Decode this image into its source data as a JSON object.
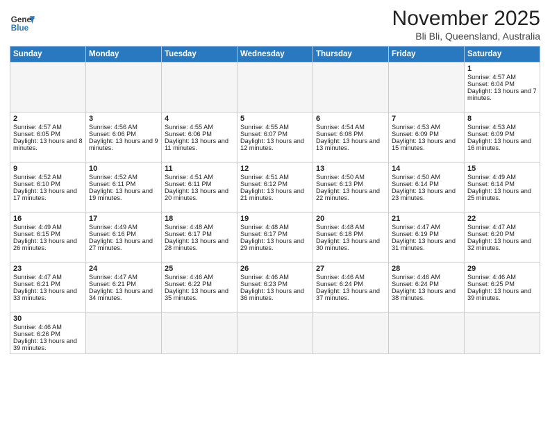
{
  "logo": {
    "text_general": "General",
    "text_blue": "Blue"
  },
  "title": "November 2025",
  "subtitle": "Bli Bli, Queensland, Australia",
  "days_of_week": [
    "Sunday",
    "Monday",
    "Tuesday",
    "Wednesday",
    "Thursday",
    "Friday",
    "Saturday"
  ],
  "weeks": [
    [
      {
        "day": "",
        "info": "",
        "empty": true
      },
      {
        "day": "",
        "info": "",
        "empty": true
      },
      {
        "day": "",
        "info": "",
        "empty": true
      },
      {
        "day": "",
        "info": "",
        "empty": true
      },
      {
        "day": "",
        "info": "",
        "empty": true
      },
      {
        "day": "",
        "info": "",
        "empty": true
      },
      {
        "day": "1",
        "info": "Sunrise: 4:57 AM\nSunset: 6:04 PM\nDaylight: 13 hours and 7 minutes."
      }
    ],
    [
      {
        "day": "2",
        "info": "Sunrise: 4:57 AM\nSunset: 6:05 PM\nDaylight: 13 hours and 8 minutes."
      },
      {
        "day": "3",
        "info": "Sunrise: 4:56 AM\nSunset: 6:06 PM\nDaylight: 13 hours and 9 minutes."
      },
      {
        "day": "4",
        "info": "Sunrise: 4:55 AM\nSunset: 6:06 PM\nDaylight: 13 hours and 11 minutes."
      },
      {
        "day": "5",
        "info": "Sunrise: 4:55 AM\nSunset: 6:07 PM\nDaylight: 13 hours and 12 minutes."
      },
      {
        "day": "6",
        "info": "Sunrise: 4:54 AM\nSunset: 6:08 PM\nDaylight: 13 hours and 13 minutes."
      },
      {
        "day": "7",
        "info": "Sunrise: 4:53 AM\nSunset: 6:09 PM\nDaylight: 13 hours and 15 minutes."
      },
      {
        "day": "8",
        "info": "Sunrise: 4:53 AM\nSunset: 6:09 PM\nDaylight: 13 hours and 16 minutes."
      }
    ],
    [
      {
        "day": "9",
        "info": "Sunrise: 4:52 AM\nSunset: 6:10 PM\nDaylight: 13 hours and 17 minutes."
      },
      {
        "day": "10",
        "info": "Sunrise: 4:52 AM\nSunset: 6:11 PM\nDaylight: 13 hours and 19 minutes."
      },
      {
        "day": "11",
        "info": "Sunrise: 4:51 AM\nSunset: 6:11 PM\nDaylight: 13 hours and 20 minutes."
      },
      {
        "day": "12",
        "info": "Sunrise: 4:51 AM\nSunset: 6:12 PM\nDaylight: 13 hours and 21 minutes."
      },
      {
        "day": "13",
        "info": "Sunrise: 4:50 AM\nSunset: 6:13 PM\nDaylight: 13 hours and 22 minutes."
      },
      {
        "day": "14",
        "info": "Sunrise: 4:50 AM\nSunset: 6:14 PM\nDaylight: 13 hours and 23 minutes."
      },
      {
        "day": "15",
        "info": "Sunrise: 4:49 AM\nSunset: 6:14 PM\nDaylight: 13 hours and 25 minutes."
      }
    ],
    [
      {
        "day": "16",
        "info": "Sunrise: 4:49 AM\nSunset: 6:15 PM\nDaylight: 13 hours and 26 minutes."
      },
      {
        "day": "17",
        "info": "Sunrise: 4:49 AM\nSunset: 6:16 PM\nDaylight: 13 hours and 27 minutes."
      },
      {
        "day": "18",
        "info": "Sunrise: 4:48 AM\nSunset: 6:17 PM\nDaylight: 13 hours and 28 minutes."
      },
      {
        "day": "19",
        "info": "Sunrise: 4:48 AM\nSunset: 6:17 PM\nDaylight: 13 hours and 29 minutes."
      },
      {
        "day": "20",
        "info": "Sunrise: 4:48 AM\nSunset: 6:18 PM\nDaylight: 13 hours and 30 minutes."
      },
      {
        "day": "21",
        "info": "Sunrise: 4:47 AM\nSunset: 6:19 PM\nDaylight: 13 hours and 31 minutes."
      },
      {
        "day": "22",
        "info": "Sunrise: 4:47 AM\nSunset: 6:20 PM\nDaylight: 13 hours and 32 minutes."
      }
    ],
    [
      {
        "day": "23",
        "info": "Sunrise: 4:47 AM\nSunset: 6:21 PM\nDaylight: 13 hours and 33 minutes."
      },
      {
        "day": "24",
        "info": "Sunrise: 4:47 AM\nSunset: 6:21 PM\nDaylight: 13 hours and 34 minutes."
      },
      {
        "day": "25",
        "info": "Sunrise: 4:46 AM\nSunset: 6:22 PM\nDaylight: 13 hours and 35 minutes."
      },
      {
        "day": "26",
        "info": "Sunrise: 4:46 AM\nSunset: 6:23 PM\nDaylight: 13 hours and 36 minutes."
      },
      {
        "day": "27",
        "info": "Sunrise: 4:46 AM\nSunset: 6:24 PM\nDaylight: 13 hours and 37 minutes."
      },
      {
        "day": "28",
        "info": "Sunrise: 4:46 AM\nSunset: 6:24 PM\nDaylight: 13 hours and 38 minutes."
      },
      {
        "day": "29",
        "info": "Sunrise: 4:46 AM\nSunset: 6:25 PM\nDaylight: 13 hours and 39 minutes."
      }
    ],
    [
      {
        "day": "30",
        "info": "Sunrise: 4:46 AM\nSunset: 6:26 PM\nDaylight: 13 hours and 39 minutes.",
        "last": true
      },
      {
        "day": "",
        "info": "",
        "empty": true,
        "last": true
      },
      {
        "day": "",
        "info": "",
        "empty": true,
        "last": true
      },
      {
        "day": "",
        "info": "",
        "empty": true,
        "last": true
      },
      {
        "day": "",
        "info": "",
        "empty": true,
        "last": true
      },
      {
        "day": "",
        "info": "",
        "empty": true,
        "last": true
      },
      {
        "day": "",
        "info": "",
        "empty": true,
        "last": true
      }
    ]
  ]
}
